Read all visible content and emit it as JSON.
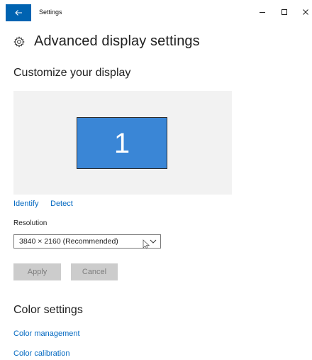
{
  "titlebar": {
    "title": "Settings",
    "icons": {
      "back": "back-arrow-icon",
      "minimize": "minimize-icon",
      "maximize": "maximize-icon",
      "close": "close-icon"
    },
    "accent_color": "#0063b1"
  },
  "header": {
    "title": "Advanced display settings",
    "icon": "gear-icon"
  },
  "customize": {
    "section_title": "Customize your display",
    "monitor_label": "1",
    "monitor_color": "#3a86d6",
    "identify_label": "Identify",
    "detect_label": "Detect"
  },
  "resolution": {
    "label": "Resolution",
    "selected_value": "3840 × 2160 (Recommended)"
  },
  "actions": {
    "apply_label": "Apply",
    "cancel_label": "Cancel",
    "enabled": false
  },
  "color": {
    "section_title": "Color settings",
    "management_label": "Color management",
    "calibration_label": "Color calibration"
  },
  "link_color": "#0067c0"
}
